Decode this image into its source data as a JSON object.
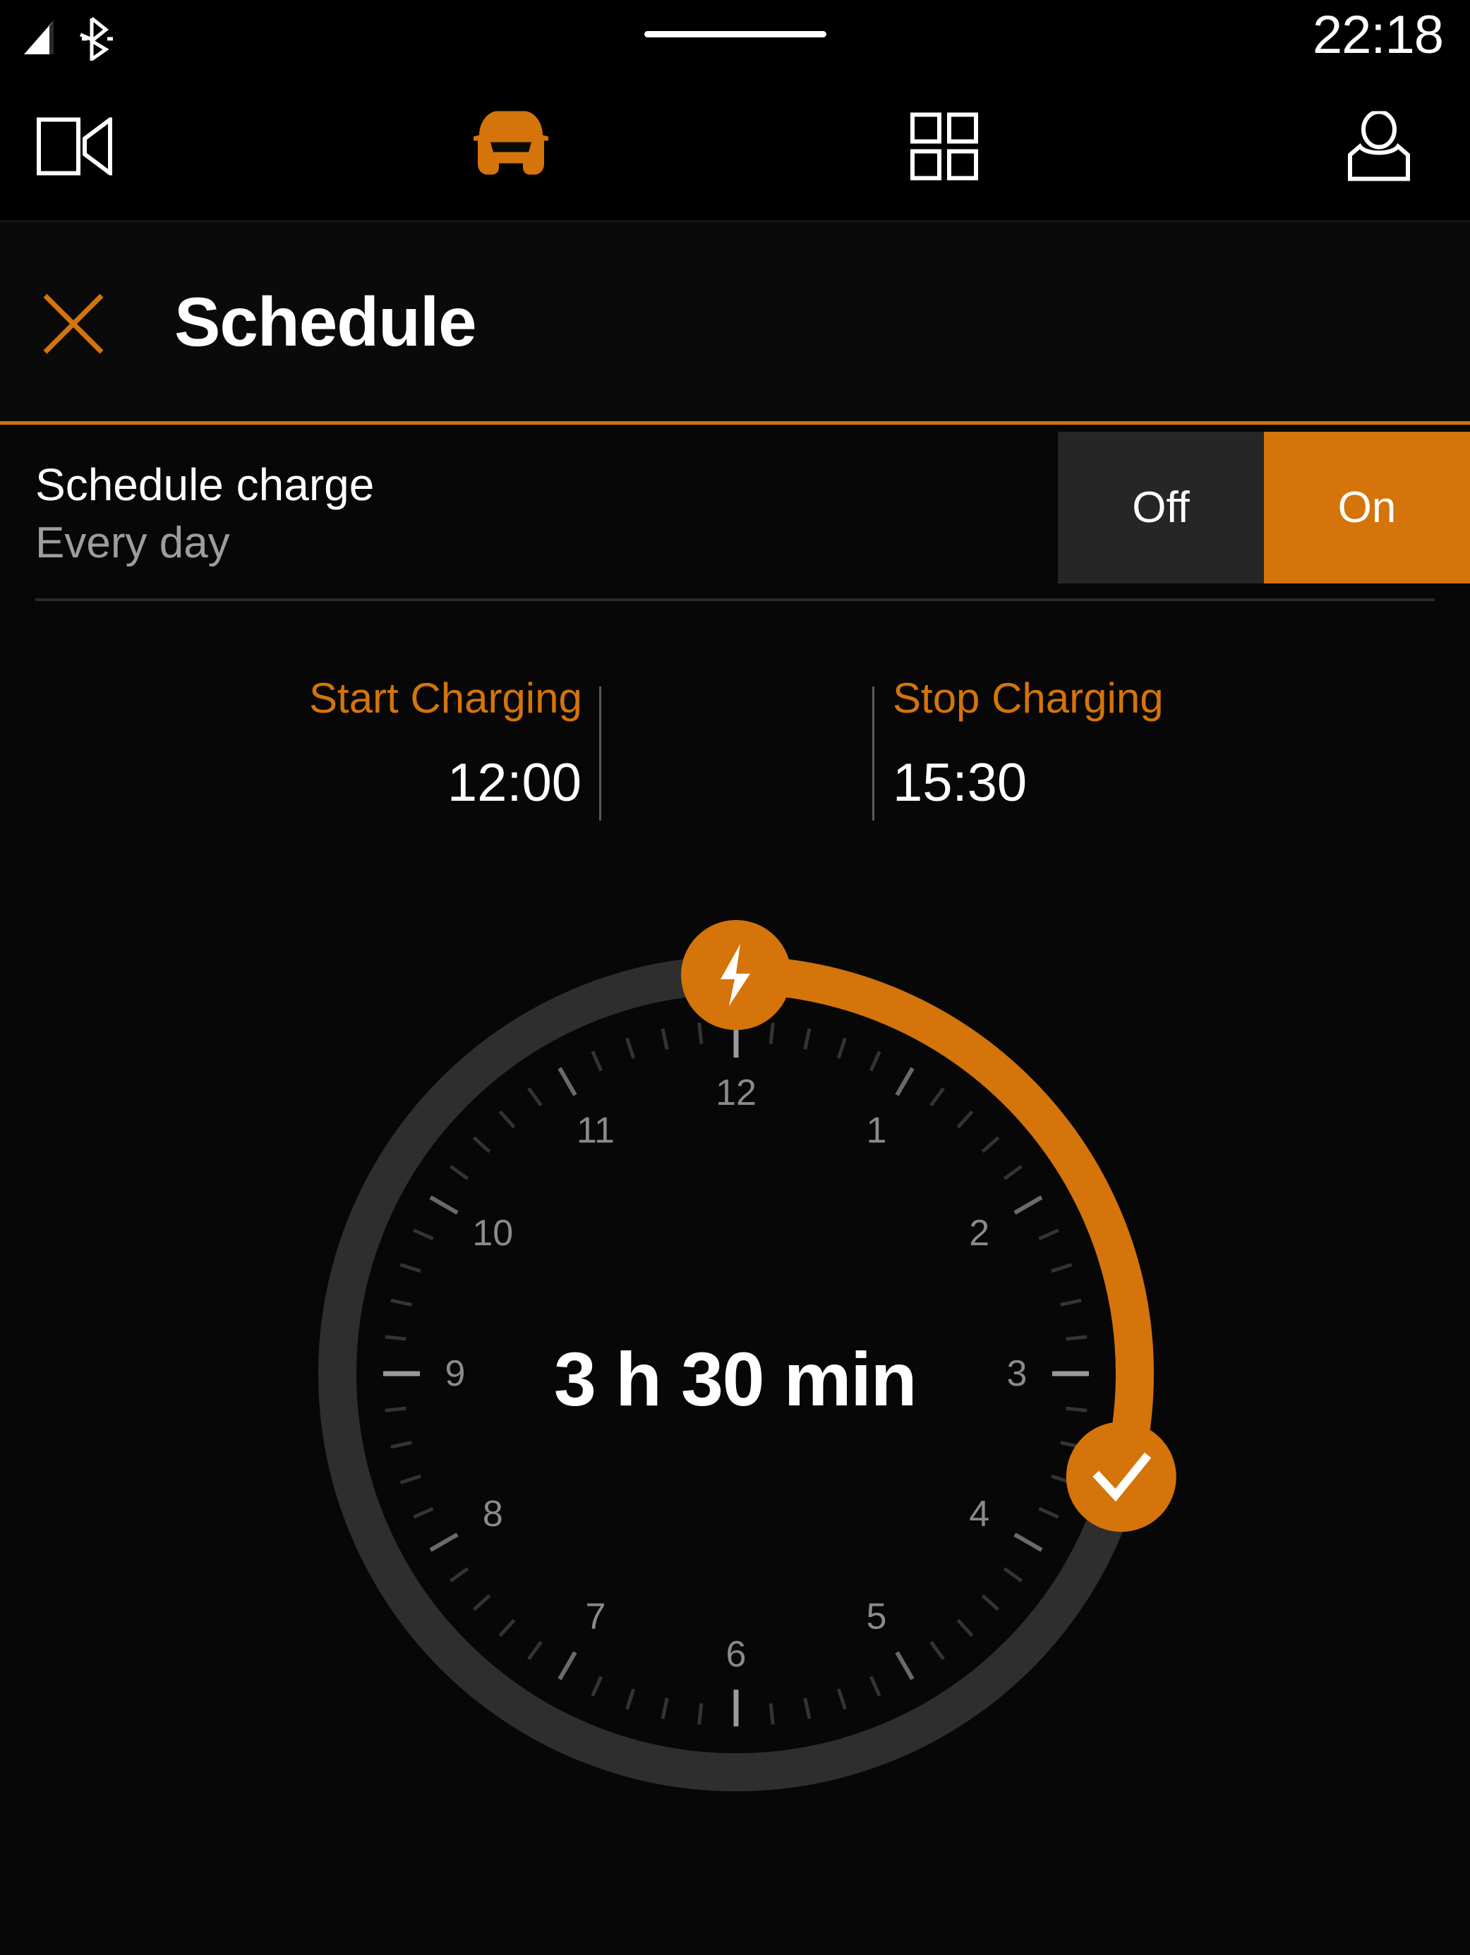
{
  "status_bar": {
    "time": "22:18",
    "icons": [
      "signal-icon",
      "bluetooth-icon"
    ]
  },
  "nav_bar": {
    "items": [
      {
        "name": "media-icon",
        "active": false
      },
      {
        "name": "car-icon",
        "active": true
      },
      {
        "name": "apps-grid-icon",
        "active": false
      },
      {
        "name": "profile-icon",
        "active": false
      }
    ]
  },
  "header": {
    "title": "Schedule",
    "close_icon": "close-x-icon"
  },
  "schedule": {
    "label": "Schedule charge",
    "sublabel": "Every day",
    "toggle": {
      "off_label": "Off",
      "on_label": "On",
      "selected": "On"
    }
  },
  "charge_times": {
    "start": {
      "label": "Start Charging",
      "value": "12:00"
    },
    "stop": {
      "label": "Stop Charging",
      "value": "15:30"
    }
  },
  "dial": {
    "duration_label": "3 h 30 min",
    "start_handle_icon": "lightning-bolt-icon",
    "stop_handle_icon": "checkmark-icon",
    "hour_numbers": [
      "12",
      "1",
      "2",
      "3",
      "4",
      "5",
      "6",
      "7",
      "8",
      "9",
      "10",
      "11"
    ],
    "start_angle_deg": 0,
    "stop_angle_deg": 105
  },
  "colors": {
    "accent_orange": "#d4740a",
    "background": "#0a0a0a",
    "track_gray": "#2e2e2e",
    "text_white": "#ffffff",
    "text_muted": "#9d9d9d",
    "tick_gray": "#8a8a8a"
  }
}
